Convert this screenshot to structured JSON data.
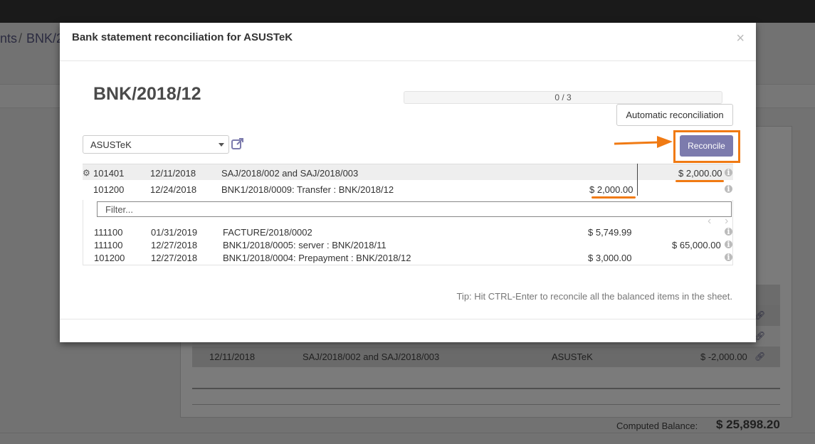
{
  "background": {
    "breadcrumb": [
      "nts",
      "BNK/2"
    ],
    "breadcrumb_sep": "/",
    "rows": [
      {
        "date": "12/11/2018",
        "ref": "SAJ/2018/002 and SAJ/2018/003",
        "partner": "ASUSTeK",
        "amount": "$ -2,000.00"
      }
    ],
    "computed_balance_label": "Computed Balance:",
    "computed_balance_value": "$ 25,898.20"
  },
  "modal": {
    "title": "Bank statement reconciliation for ASUSTeK",
    "close": "×",
    "statement_name": "BNK/2018/12",
    "progress_text": "0 / 3",
    "progress": 0,
    "auto_reconcile_label": "Automatic reconciliation",
    "partner": "ASUSTeK",
    "reconcile_label": "Reconcile",
    "filter_placeholder": "Filter...",
    "tip": "Tip: Hit CTRL-Enter to reconcile all the balanced items in the sheet.",
    "accent_color": "#7c7bad",
    "highlight_color": "#f07a13"
  },
  "selected_lines": [
    {
      "account": "101401",
      "date": "12/11/2018",
      "label": "SAJ/2018/002 and SAJ/2018/003",
      "debit": "",
      "credit": "$ 2,000.00"
    },
    {
      "account": "101200",
      "date": "12/24/2018",
      "label": "BNK1/2018/0009: Transfer : BNK/2018/12",
      "debit": "$ 2,000.00",
      "credit": ""
    }
  ],
  "match_lines": [
    {
      "account": "111100",
      "date": "01/31/2019",
      "label": "FACTURE/2018/0002",
      "debit": "$ 5,749.99",
      "credit": ""
    },
    {
      "account": "111100",
      "date": "12/27/2018",
      "label": "BNK1/2018/0005: server : BNK/2018/11",
      "debit": "",
      "credit": "$ 65,000.00"
    },
    {
      "account": "101200",
      "date": "12/27/2018",
      "label": "BNK1/2018/0004: Prepayment : BNK/2018/12",
      "debit": "$ 3,000.00",
      "credit": ""
    }
  ],
  "icons": {
    "gear": "gear-icon",
    "info": "info-icon",
    "external_link": "external-link-icon",
    "prev": "chevron-left-icon",
    "next": "chevron-right-icon",
    "link": "link-icon"
  }
}
